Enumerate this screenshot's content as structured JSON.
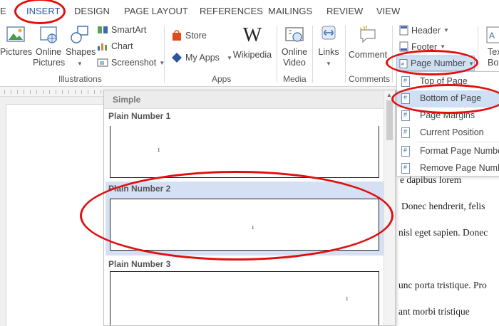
{
  "tabs": [
    "E",
    "INSERT",
    "DESIGN",
    "PAGE LAYOUT",
    "REFERENCES",
    "MAILINGS",
    "REVIEW",
    "VIEW"
  ],
  "ribbon": {
    "pictures": "Pictures",
    "online_pictures": "Online Pictures",
    "shapes": "Shapes",
    "smartart": "SmartArt",
    "chart": "Chart",
    "screenshot": "Screenshot",
    "store": "Store",
    "my_apps": "My Apps",
    "wikipedia": "Wikipedia",
    "online_video": "Online Video",
    "links": "Links",
    "comment": "Comment",
    "header": "Header",
    "footer": "Footer",
    "page_number": "Page Number",
    "text_box": "Text Box",
    "groups": {
      "illustrations": "Illustrations",
      "apps": "Apps",
      "media": "Media",
      "comments": "Comments"
    }
  },
  "gallery": {
    "header": "Simple",
    "items": [
      {
        "name": "Plain Number 1",
        "num": "1"
      },
      {
        "name": "Plain Number 2",
        "num": "1"
      },
      {
        "name": "Plain Number 3",
        "num": "1"
      }
    ]
  },
  "page_number_menu": {
    "items": [
      "Top of Page",
      "Bottom of Page",
      "Page Margins",
      "Current Position",
      "Format Page Numbers...",
      "Remove Page Numbers"
    ]
  },
  "document": {
    "lines": [
      "e dapibus lorem",
      "Donec hendrerit, felis",
      "nisl eget sapien. Donec",
      "unc porta tristique. Pro",
      "ant morbi tristique"
    ]
  },
  "annotation_color": "#e01010"
}
